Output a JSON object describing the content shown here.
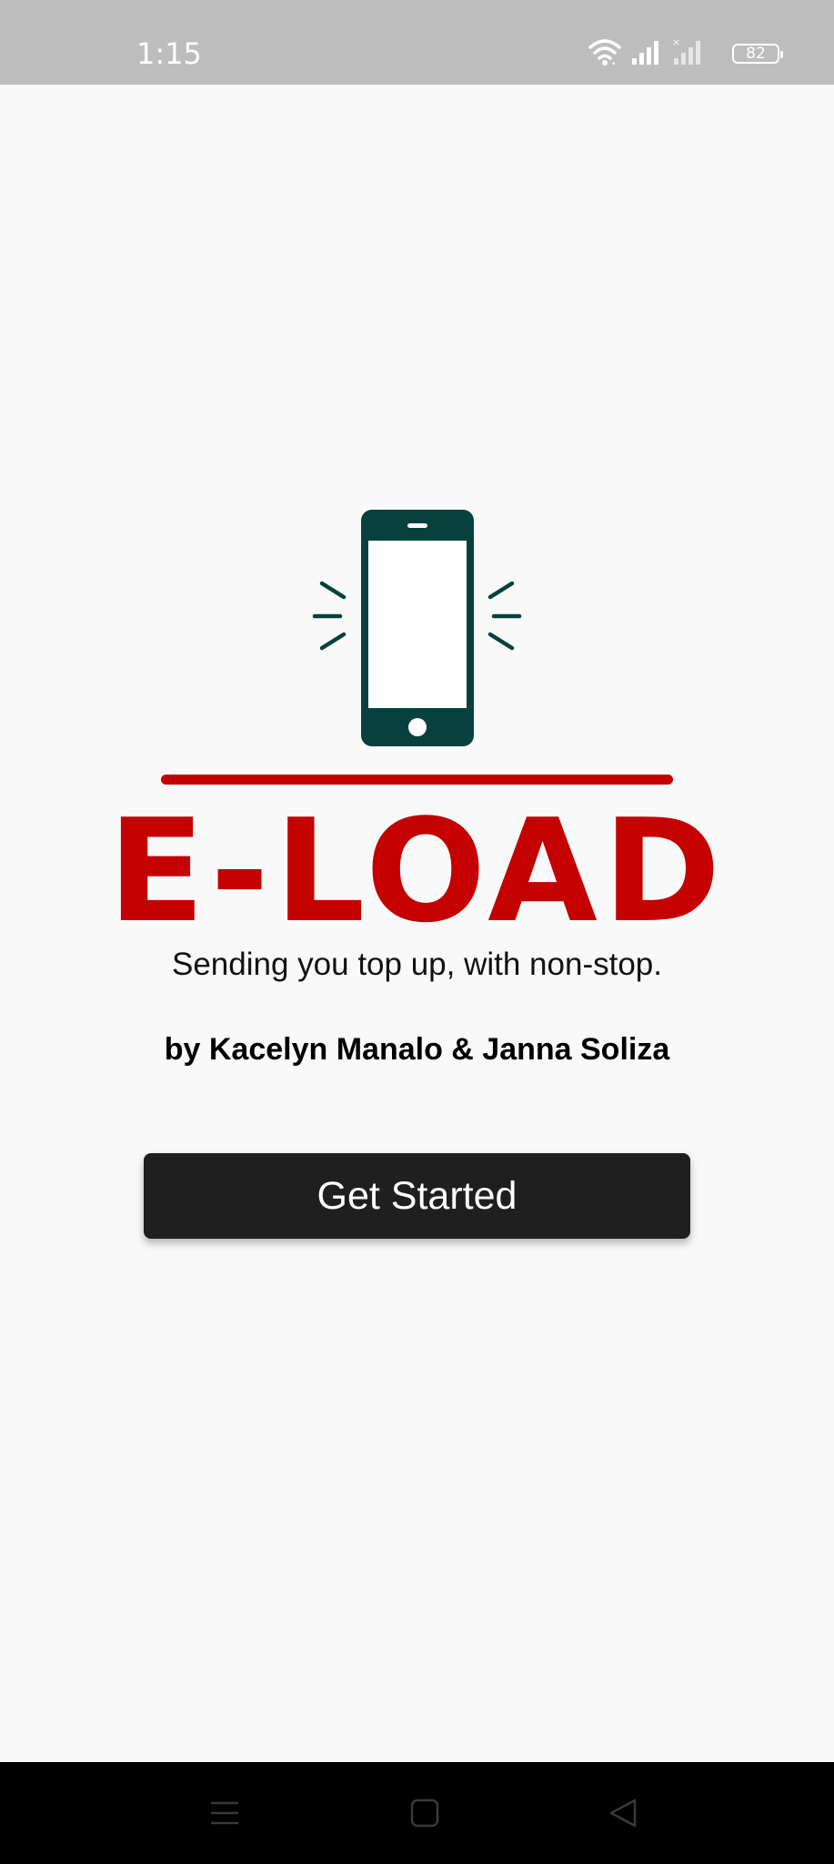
{
  "status_bar": {
    "time": "1:15",
    "battery_level": "82",
    "icons": [
      "wifi-icon",
      "signal-icon",
      "signal-no-sim-icon",
      "battery-icon"
    ]
  },
  "app": {
    "title": "E-LOAD",
    "tagline": "Sending you top up, with non-stop.",
    "authors": "by Kacelyn Manalo & Janna Soliza",
    "get_started_label": "Get Started",
    "logo_icon": "vibrating-phone-icon"
  },
  "colors": {
    "background": "#f9f9f9",
    "status_bar": "#bdbdbd",
    "brand_red": "#c40000",
    "phone_icon": "#07413d",
    "button": "#1f1f1f",
    "nav_bar": "#000000"
  },
  "nav_bar": {
    "buttons": [
      "menu-icon",
      "home-icon",
      "back-icon"
    ]
  }
}
